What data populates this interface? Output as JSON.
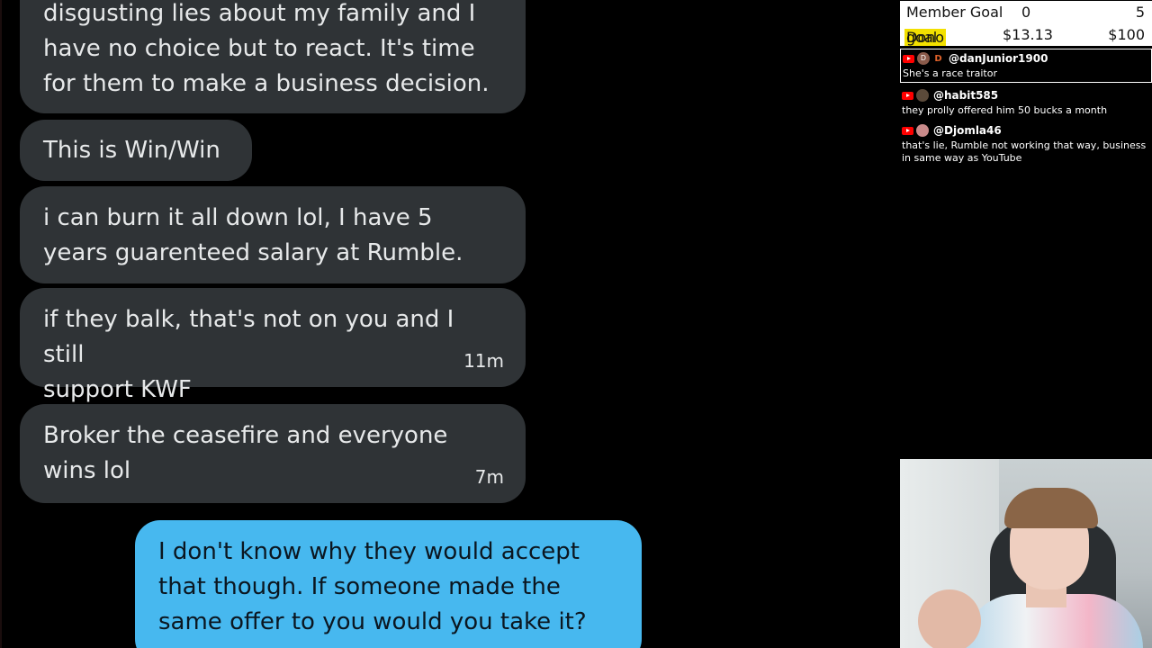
{
  "messages": [
    {
      "text": "disgusting lies about my family and I\nhave no choice but to react.  It's time\nfor them to make a business decision.",
      "time": ""
    },
    {
      "text": "This is Win/Win",
      "time": ""
    },
    {
      "text": "i  can burn it all down lol, I have 5\nyears guarenteed salary at Rumble.",
      "time": ""
    },
    {
      "text": "if they balk, that's not on you and I still\nsupport KWF",
      "time": "11m"
    },
    {
      "text": "Broker the ceasefire and everyone\nwins lol",
      "time": "7m"
    },
    {
      "text": "I don't know why they would accept\nthat though. If someone made the\nsame offer to you would you take it?",
      "time": ""
    }
  ],
  "goals": {
    "member": {
      "label": "Member Goal",
      "current": "0",
      "target": "5"
    },
    "dono": {
      "label_highlight": "Dono",
      "label_rest": " goal",
      "current": "$13.13",
      "target": "$100"
    }
  },
  "live_chat": [
    {
      "username": "@danJunior1900",
      "text": "She's a race traitor",
      "avatar_letter": "D",
      "avatar_color": "#8a5a4a"
    },
    {
      "username": "@habit585",
      "text": "they prolly offered him 50 bucks a month",
      "avatar_letter": "",
      "avatar_color": "#5b4a3a"
    },
    {
      "username": "@Djomla46",
      "text": "that's lie, Rumble not working that way, business in same way as YouTube",
      "avatar_letter": "",
      "avatar_color": "#c98a8a"
    }
  ],
  "colors": {
    "incoming_bubble": "#2f3336",
    "outgoing_bubble": "#47b8ef",
    "dono_highlight": "#f3e000",
    "youtube_red": "#ff0000"
  },
  "icons": [
    "youtube-icon",
    "avatar",
    "member-badge-icon"
  ]
}
